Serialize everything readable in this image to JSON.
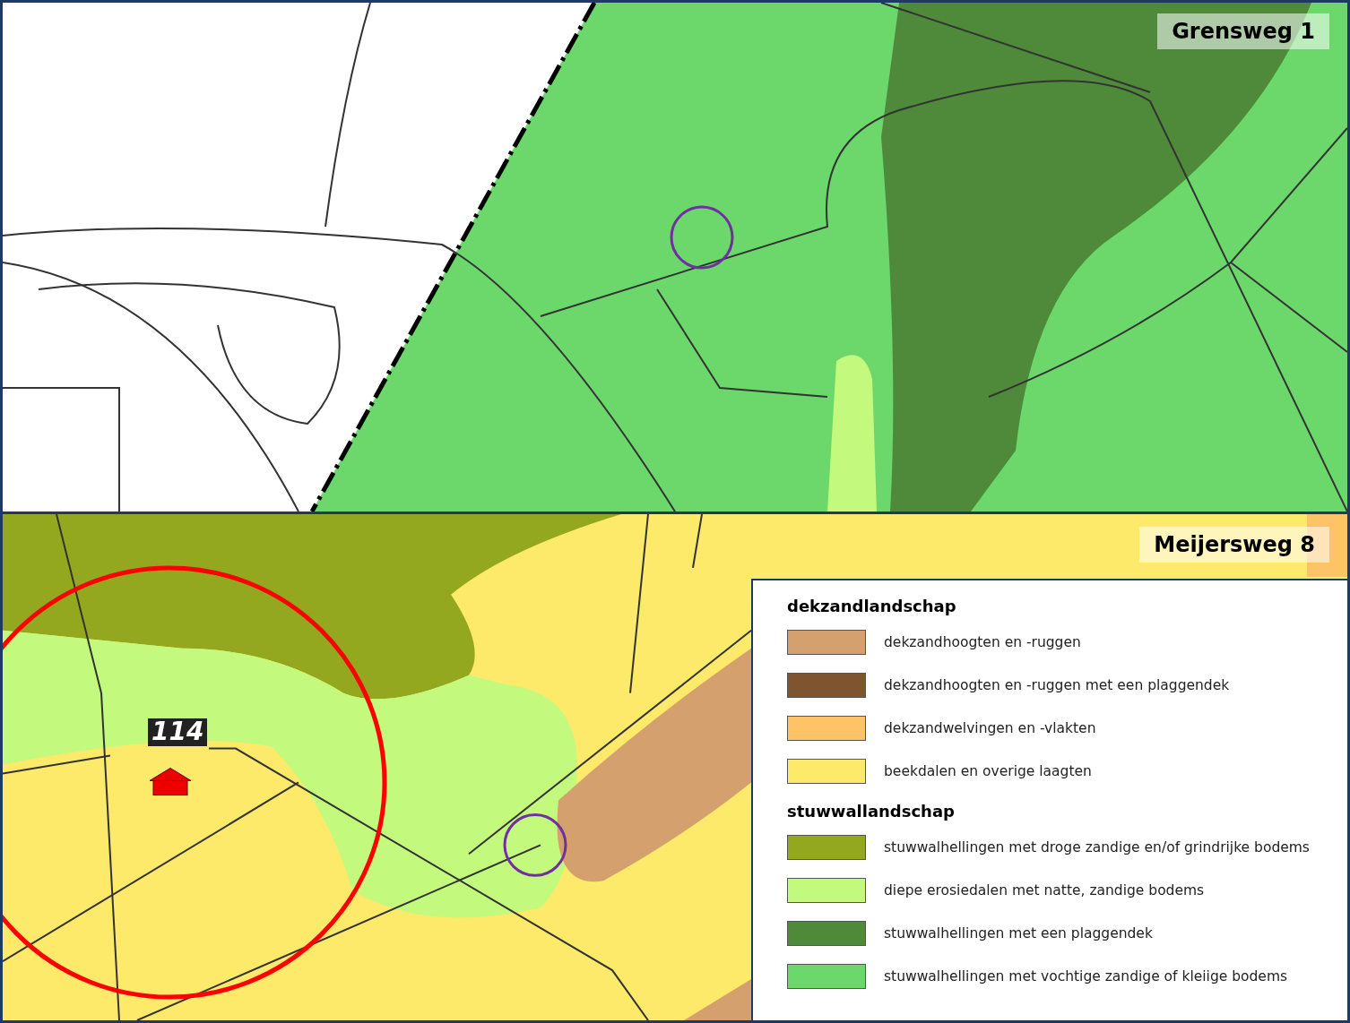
{
  "panels": [
    {
      "kind": "forest",
      "label": "Grensweg 1"
    },
    {
      "kind": "heath",
      "label": "Meijersweg 8",
      "marker_label": "114"
    }
  ],
  "legend": {
    "sections": [
      {
        "title": "dekzandlandschap",
        "items": [
          {
            "label": "dekzandhoogten en -ruggen",
            "color": "#d4a06e"
          },
          {
            "label": "dekzandhoogten en -ruggen met een plaggendek",
            "color": "#7f5530"
          },
          {
            "label": "dekzandwelvingen en -vlakten",
            "color": "#fdc366"
          },
          {
            "label": "beekdalen en overige laagten",
            "color": "#fde96a"
          }
        ]
      },
      {
        "title": "stuwwallandschap",
        "items": [
          {
            "label": "stuwwalhellingen met droge zandige en/of grindrijke bodems",
            "color": "#93a81e"
          },
          {
            "label": "diepe erosiedalen met natte, zandige bodems",
            "color": "#c3f97c"
          },
          {
            "label": "stuwwalhellingen met een plaggendek",
            "color": "#4f8a3b"
          },
          {
            "label": "stuwwalhellingen met vochtige zandige of kleiige bodems",
            "color": "#6cd86c"
          }
        ]
      }
    ]
  }
}
